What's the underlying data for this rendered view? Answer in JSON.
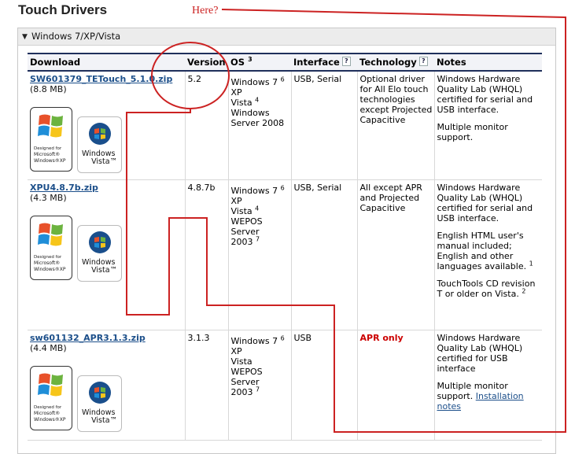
{
  "page": {
    "title": "Touch Drivers"
  },
  "annotation": {
    "label": "Here?"
  },
  "panel": {
    "toggle_glyph": "▼",
    "title": "Windows 7/XP/Vista"
  },
  "table": {
    "headers": {
      "download": "Download",
      "version": "Version",
      "os": "OS",
      "os_note": "3",
      "interface": "Interface",
      "technology": "Technology",
      "notes": "Notes",
      "help_glyph": "?"
    },
    "rows": [
      {
        "file": "SW601379_TETouch_5.1.0.zip",
        "size": "(8.8 MB)",
        "version": "5.2",
        "os_lines": [
          "Windows 7",
          "XP",
          "Vista",
          "Windows",
          "Server 2008"
        ],
        "os_sup": {
          "win7": "6",
          "vista": "4"
        },
        "interface": "USB, Serial",
        "technology": "Optional driver for All Elo touch technologies except Projected Capacitive",
        "notes": [
          "Windows Hardware Quality Lab (WHQL) certified for serial and USB interface.",
          "Multiple monitor support."
        ]
      },
      {
        "file": "XPU4.8.7b.zip",
        "size": "(4.3 MB)",
        "version": "4.8.7b",
        "os_lines": [
          "Windows 7",
          "XP",
          "Vista",
          "WEPOS",
          "Server",
          "2003"
        ],
        "os_sup": {
          "win7": "6",
          "vista": "4",
          "server": "7"
        },
        "interface": "USB, Serial",
        "technology": "All except APR and Projected Capacitive",
        "notes": [
          "Windows Hardware Quality Lab (WHQL) certified for serial and USB interface.",
          "English HTML user's manual included; English and other languages available.",
          "TouchTools CD revision T or older on Vista."
        ],
        "note_sups": [
          "1",
          "2"
        ]
      },
      {
        "file": "sw601132_APR3.1.3.zip",
        "size": "(4.4 MB)",
        "version": "3.1.3",
        "os_lines": [
          "Windows 7",
          "XP",
          "Vista",
          "WEPOS",
          "Server",
          "2003"
        ],
        "os_sup": {
          "win7": "6",
          "server": "7"
        },
        "interface": "USB",
        "technology": "APR only",
        "notes": [
          "Windows Hardware Quality Lab (WHQL) certified for USB interface",
          "Multiple monitor support."
        ],
        "install_link": "Installation notes"
      }
    ]
  },
  "logos": {
    "xp": {
      "designed": "Designed for",
      "line1": "Microsoft®",
      "line2": "Windows®XP"
    },
    "vista": {
      "line1": "Windows",
      "line2": "Vista™"
    }
  },
  "colors": {
    "annotation": "#cc2222",
    "link": "#1c4f8a",
    "header_rule": "#1f2f5b",
    "apr": "#cc0000"
  }
}
